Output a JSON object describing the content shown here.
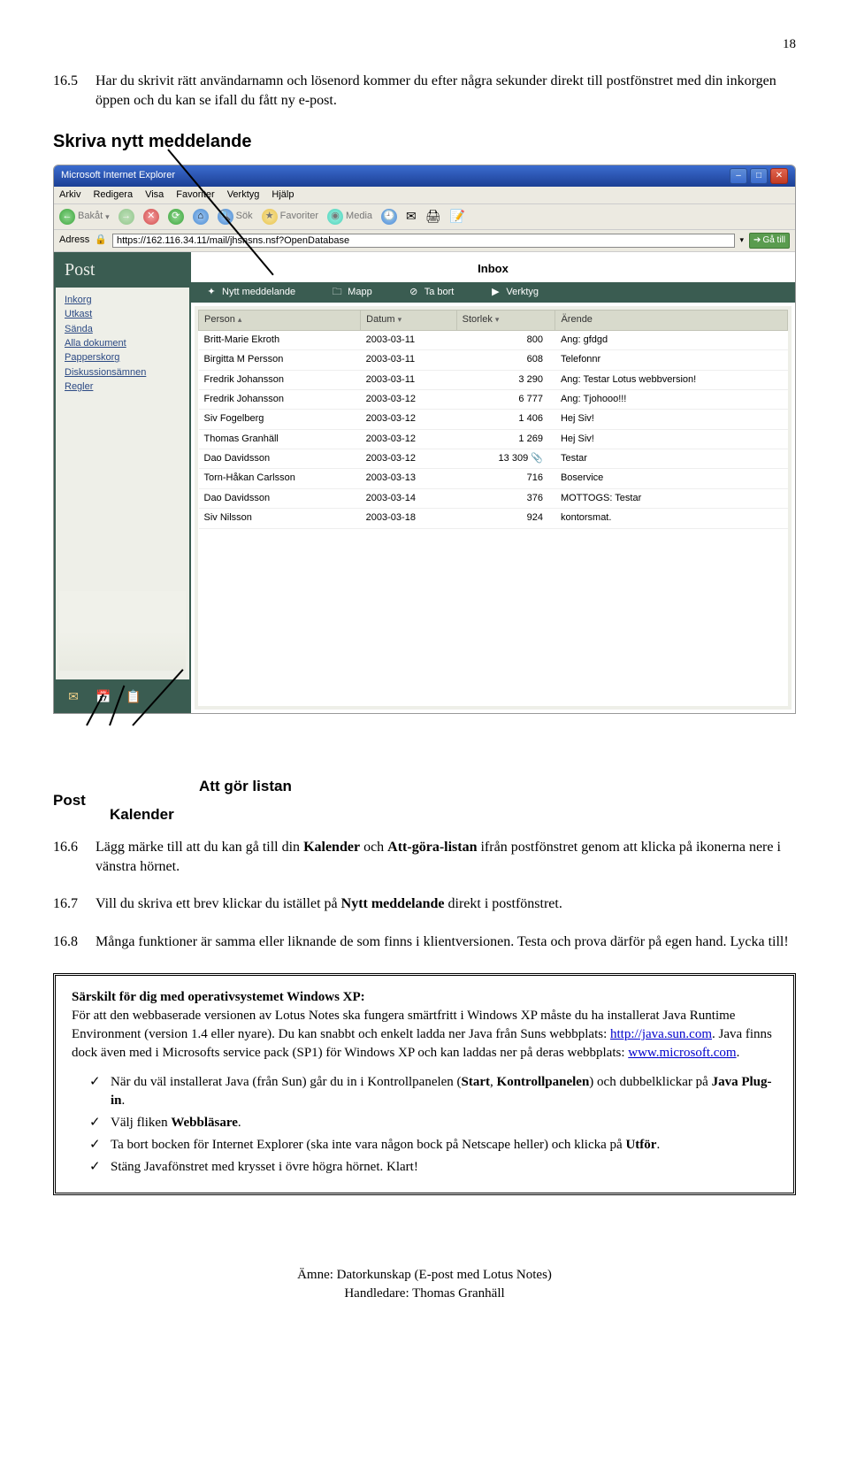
{
  "page_number": "18",
  "para_16_5": {
    "num": "16.5",
    "text": "Har du skrivit rätt användarnamn och lösenord kommer du efter några sekunder direkt till postfönstret med din inkorgen öppen och du kan se ifall du fått ny e-post."
  },
  "heading_skriva": "Skriva nytt meddelande",
  "ie": {
    "title": "Microsoft Internet Explorer",
    "menu": [
      "Arkiv",
      "Redigera",
      "Visa",
      "Favoriter",
      "Verktyg",
      "Hjälp"
    ],
    "back": "Bakåt",
    "search": "Sök",
    "fav": "Favoriter",
    "media": "Media",
    "address_label": "Adress",
    "address_value": "https://162.116.34.11/mail/jhsnsns.nsf?OpenDatabase",
    "go": "Gå till"
  },
  "app": {
    "sidebar_title": "Post",
    "side_links": [
      "Inkorg",
      "Utkast",
      "Sända",
      "Alla dokument",
      "Papperskorg",
      "Diskussionsämnen",
      "Regler"
    ],
    "inbox_title": "Inbox",
    "toolbar": {
      "new": "Nytt meddelande",
      "folder": "Mapp",
      "delete": "Ta bort",
      "tools": "Verktyg"
    },
    "columns": {
      "person": "Person",
      "date": "Datum",
      "size": "Storlek",
      "subject": "Ärende"
    },
    "rows": [
      {
        "person": "Britt-Marie Ekroth",
        "date": "2003-03-11",
        "size": "800",
        "subj": "Ang: gfdgd"
      },
      {
        "person": "Birgitta M Persson",
        "date": "2003-03-11",
        "size": "608",
        "subj": "Telefonnr"
      },
      {
        "person": "Fredrik Johansson",
        "date": "2003-03-11",
        "size": "3 290",
        "subj": "Ang: Testar Lotus webbversion!"
      },
      {
        "person": "Fredrik Johansson",
        "date": "2003-03-12",
        "size": "6 777",
        "subj": "Ang: Tjohooo!!!"
      },
      {
        "person": "Siv Fogelberg",
        "date": "2003-03-12",
        "size": "1 406",
        "subj": "Hej Siv!"
      },
      {
        "person": "Thomas Granhäll",
        "date": "2003-03-12",
        "size": "1 269",
        "subj": "Hej Siv!"
      },
      {
        "person": "Dao Davidsson",
        "date": "2003-03-12",
        "size": "13 309",
        "subj": "Testar",
        "clip": true
      },
      {
        "person": "Torn-Håkan Carlsson",
        "date": "2003-03-13",
        "size": "716",
        "subj": "Boservice"
      },
      {
        "person": "Dao Davidsson",
        "date": "2003-03-14",
        "size": "376",
        "subj": "MOTTOGS: Testar"
      },
      {
        "person": "Siv Nilsson",
        "date": "2003-03-18",
        "size": "924",
        "subj": "kontorsmat."
      }
    ]
  },
  "labels_below": {
    "post": "Post",
    "kalender": "Kalender",
    "attgor": "Att gör listan"
  },
  "para_16_6": {
    "num": "16.6",
    "text_start": "Lägg märke till att du kan gå till din ",
    "kalender": "Kalender",
    "mid": " och ",
    "attgora": "Att-göra-listan",
    "text_end": " ifrån postfönstret genom att klicka på ikonerna nere i vänstra hörnet."
  },
  "para_16_7": {
    "num": "16.7",
    "text_start": "Vill du skriva ett brev klickar du istället på ",
    "bold": "Nytt meddelande",
    "text_end": " direkt i postfönstret."
  },
  "para_16_8": {
    "num": "16.8",
    "text": "Många funktioner är samma eller liknande de som finns i klientversionen. Testa och prova därför på egen hand. Lycka till!"
  },
  "box": {
    "title": "Särskilt för dig med operativsystemet Windows XP:",
    "p1_a": "För att den webbaserade versionen av Lotus Notes ska fungera smärtfritt i Windows XP måste du ha installerat Java Runtime Environment (version 1.4 eller nyare). Du kan snabbt och enkelt ladda ner Java från Suns webbplats: ",
    "link1": "http://java.sun.com",
    "p1_b": ". Java finns dock även med i Microsofts service pack (SP1) för Windows XP och kan laddas ner på deras webbplats: ",
    "link2": "www.microsoft.com",
    "p1_c": ".",
    "li1_a": "När du väl installerat Java (från Sun) går du in i Kontrollpanelen (",
    "li1_b1": "Start",
    "li1_c": ", ",
    "li1_b2": "Kontrollpanelen",
    "li1_d": ") och dubbelklickar på ",
    "li1_b3": "Java Plug-in",
    "li1_e": ".",
    "li2_a": "Välj fliken ",
    "li2_b": "Webbläsare",
    "li2_c": ".",
    "li3_a": "Ta bort bocken för Internet Explorer (ska inte vara någon bock på Netscape heller) och klicka på ",
    "li3_b": "Utför",
    "li3_c": ".",
    "li4": "Stäng Javafönstret med krysset i övre högra hörnet. Klart!"
  },
  "footer": {
    "line1": "Ämne: Datorkunskap (E-post med Lotus Notes)",
    "line2": "Handledare: Thomas Granhäll"
  }
}
